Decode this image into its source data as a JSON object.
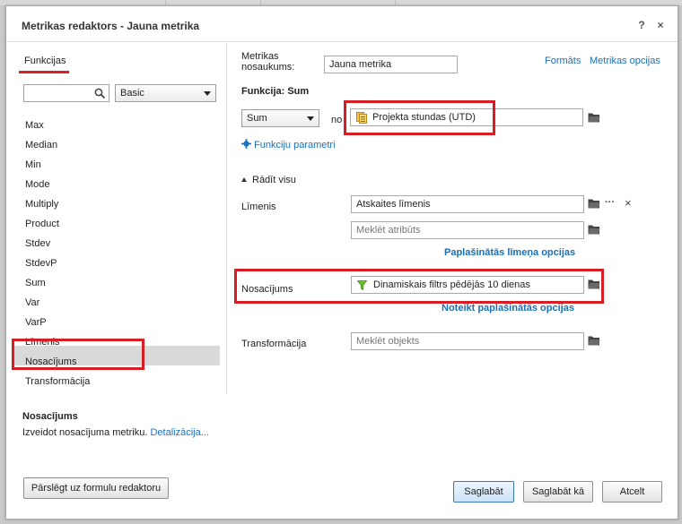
{
  "dialog": {
    "title": "Metrikas redaktors - Jauna metrika",
    "help_label": "?",
    "close_label": "×"
  },
  "left": {
    "tab_label": "Funkcijas",
    "search_placeholder": "",
    "category_select": "Basic",
    "functions": [
      "Max",
      "Median",
      "Min",
      "Mode",
      "Multiply",
      "Product",
      "Stdev",
      "StdevP",
      "Sum",
      "Var",
      "VarP",
      "Līmenis",
      "Nosacījums",
      "Transformācija"
    ],
    "selected_function": "Nosacījums"
  },
  "description": {
    "title": "Nosacījums",
    "text": "Izveidot nosacījuma metriku.",
    "link": "Detalizācija..."
  },
  "right": {
    "name_label_line1": "Metrikas",
    "name_label_line2": "nosaukums:",
    "name_value": "Jauna metrika",
    "formats_link": "Formāts",
    "options_link": "Metrikas opcijas",
    "function_heading": "Funkcija: Sum",
    "function_select": "Sum",
    "of_label": "no",
    "of_value": "Projekta stundas (UTD)",
    "params_link": "Funkciju parametri",
    "show_all_label": "Rādīt visu",
    "level_label": "Līmenis",
    "level_value": "Atskaites līmenis",
    "level_more": "···",
    "level_remove": "×",
    "attr_placeholder": "Meklēt atribūts",
    "level_options_link": "Paplašinātās līmeņa opcijas",
    "condition_label": "Nosacījums",
    "condition_value": "Dinamiskais filtrs pēdējās 10 dienas",
    "condition_options_link": "Noteikt paplašinātās opcijas",
    "transform_label": "Transformācija",
    "transform_placeholder": "Meklēt objekts"
  },
  "footer": {
    "switch_button": "Pārslēgt uz formulu redaktoru",
    "save_button": "Saglabāt",
    "save_as_button": "Saglabāt kā",
    "cancel_button": "Atcelt"
  },
  "colors": {
    "highlight_red": "#d81e25",
    "link_blue": "#1a6fb5"
  }
}
